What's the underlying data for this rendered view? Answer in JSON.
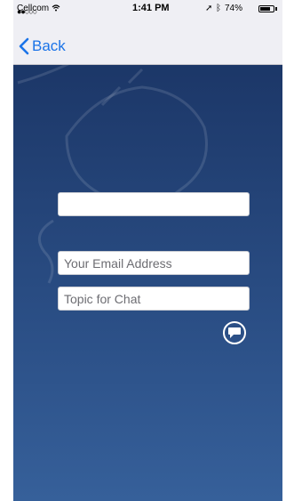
{
  "status_bar": {
    "signal": "●●○○○",
    "carrier": "Cellcom",
    "time": "1:41 PM",
    "battery": "74%"
  },
  "nav": {
    "back_label": "Back"
  },
  "form": {
    "name": {
      "value": "",
      "placeholder": ""
    },
    "email": {
      "value": "",
      "placeholder": "Your Email Address"
    },
    "topic": {
      "value": "",
      "placeholder": "Topic for Chat"
    }
  },
  "icons": {
    "back": "chevron-left-icon",
    "send": "chat-bubble-icon",
    "wifi": "wifi-icon",
    "location": "location-arrow-icon",
    "bluetooth": "bluetooth-icon",
    "battery": "battery-icon"
  },
  "colors": {
    "accent": "#1a73e8",
    "background_top": "#1c3768",
    "background_bottom": "#36609a",
    "nav_bar": "#efeff4"
  }
}
